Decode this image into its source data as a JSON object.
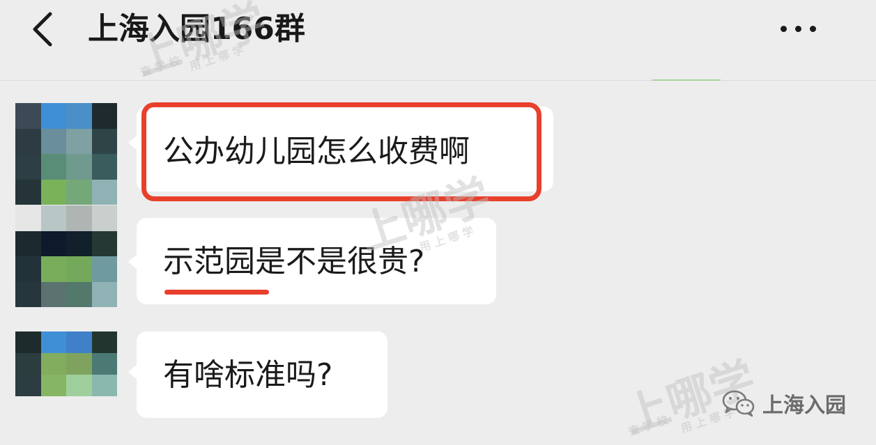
{
  "header": {
    "title": "上海入园166群",
    "back_icon": "chevron-left-icon",
    "more_icon": "more-dots-icon"
  },
  "messages": [
    {
      "text": "公办幼儿园怎么收费啊",
      "highlighted": true
    },
    {
      "text_underlined": "示范园",
      "text_rest": "是不是很贵?"
    },
    {
      "text": "有啥标准吗?"
    }
  ],
  "watermark": {
    "main": "上哪学",
    "sub_left": "查 学 校",
    "sub_right": "用 上 哪 学"
  },
  "brand": {
    "icon": "wechat-icon",
    "label": "上海入园"
  },
  "colors": {
    "background": "#ededed",
    "bubble": "#ffffff",
    "highlight": "#e8402c",
    "text": "#1a1a1a"
  }
}
